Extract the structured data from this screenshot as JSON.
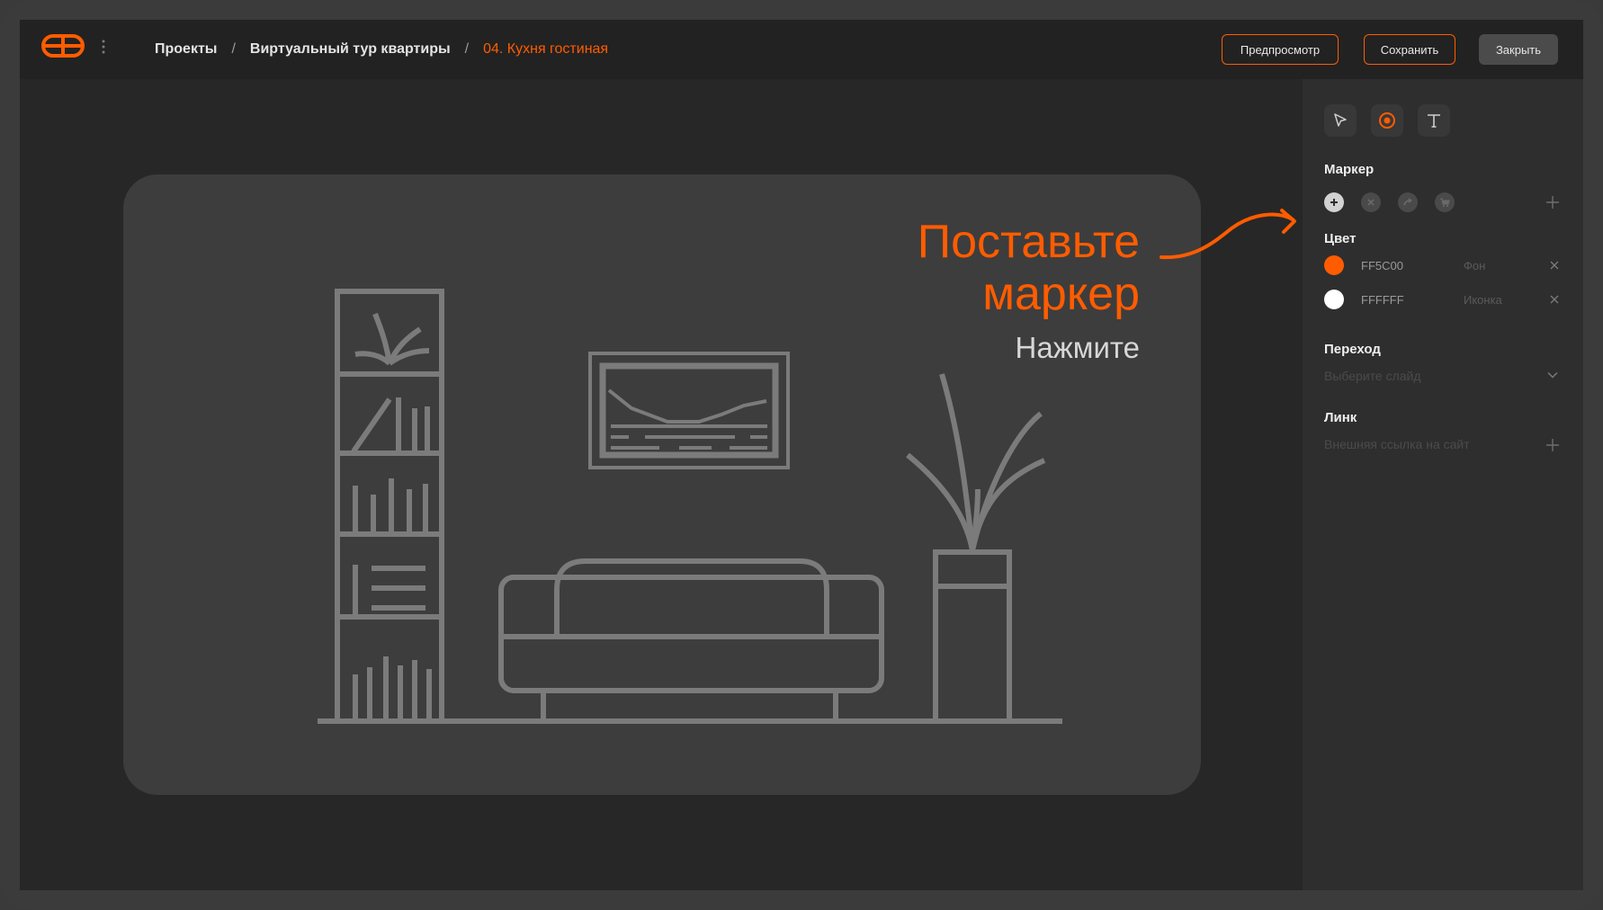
{
  "breadcrumbs": {
    "items": [
      "Проекты",
      "Виртуальный тур квартиры",
      "04. Кухня гостиная"
    ],
    "separator": "/"
  },
  "header": {
    "preview_label": "Предпросмотр",
    "save_label": "Сохранить",
    "close_label": "Закрыть"
  },
  "canvas": {
    "hint_title_line1": "Поставьте",
    "hint_title_line2": "маркер",
    "hint_subtitle": "Нажмите"
  },
  "panel": {
    "tools": [
      "cursor-icon",
      "marker-icon",
      "text-icon"
    ],
    "marker": {
      "title": "Маркер",
      "icons": [
        "plus-icon",
        "close-icon",
        "arrow-forward-icon",
        "cart-icon"
      ],
      "selected_index": 0
    },
    "color": {
      "title": "Цвет",
      "rows": [
        {
          "hex": "FF5C00",
          "role": "Фон",
          "swatch": "#ff5c00"
        },
        {
          "hex": "FFFFFF",
          "role": "Иконка",
          "swatch": "#ffffff"
        }
      ]
    },
    "transition": {
      "title": "Переход",
      "placeholder": "Выберите слайд"
    },
    "link": {
      "title": "Линк",
      "placeholder": "Внешняя ссылка на сайт"
    }
  },
  "colors": {
    "accent": "#ff5c00",
    "background": "#272727",
    "header": "#222222",
    "panel": "#2e2e2e",
    "stage": "#3d3d3d",
    "line_art": "#7b7b7b"
  }
}
